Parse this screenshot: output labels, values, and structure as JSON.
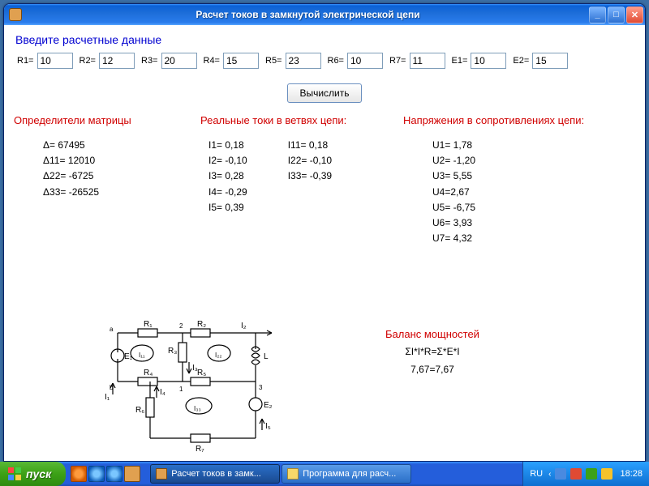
{
  "window": {
    "title": "Расчет токов в замкнутой электрической цепи"
  },
  "prompt": "Введите  расчетные данные",
  "inputs": {
    "r1_label": "R1=",
    "r1": "10",
    "r2_label": "R2=",
    "r2": "12",
    "r3_label": "R3=",
    "r3": "20",
    "r4_label": "R4=",
    "r4": "15",
    "r5_label": "R5=",
    "r5": "23",
    "r6_label": "R6=",
    "r6": "10",
    "r7_label": "R7=",
    "r7": "11",
    "e1_label": "E1=",
    "e1": "10",
    "e2_label": "E2=",
    "e2": "15"
  },
  "calc_button": "Вычислить",
  "headings": {
    "determinants": "Определители матрицы",
    "currents": "Реальные токи в ветвях цепи:",
    "voltages": "Напряжения в сопротивлениях цепи:"
  },
  "determinants": {
    "d": "Δ= 67495",
    "d11": "Δ11= 12010",
    "d22": "Δ22= -6725",
    "d33": "Δ33= -26525"
  },
  "currents_a": {
    "i1": "I1= 0,18",
    "i2": "I2= -0,10",
    "i3": "I3= 0,28",
    "i4": "I4= -0,29",
    "i5": "I5= 0,39"
  },
  "currents_b": {
    "i11": "I11= 0,18",
    "i22": "I22= -0,10",
    "i33": "I33= -0,39"
  },
  "voltages": {
    "u1": "U1= 1,78",
    "u2": "U2= -1,20",
    "u3": "U3= 5,55",
    "u4": "U4=2,67",
    "u5": "U5= -6,75",
    "u6": "U6= 3,93",
    "u7": "U7= 4,32"
  },
  "power": {
    "head": "Баланс мощностей",
    "formula": "ΣI*I*R=Σ*E*I",
    "result": "7,67=7,67"
  },
  "diagram_labels": {
    "r1": "R₁",
    "r2": "R₂",
    "r3": "R₃",
    "r4": "R₄",
    "r5": "R₅",
    "r6": "R₆",
    "r7": "R₇",
    "e1": "E₁",
    "e2": "E₂",
    "i1": "I₁",
    "i2": "I₂",
    "i3": "I₃",
    "i4": "I₄",
    "i5": "I₅",
    "i11": "I₁₁",
    "i22": "I₂₂",
    "i33": "I₃₃",
    "L": "L",
    "node_a": "a",
    "node_b": "b",
    "n1": "1",
    "n2": "2",
    "n3": "3"
  },
  "taskbar": {
    "start": "пуск",
    "task1": "Расчет токов в замк...",
    "task2": "Программа для расч...",
    "lang": "RU",
    "clock": "18:28"
  }
}
